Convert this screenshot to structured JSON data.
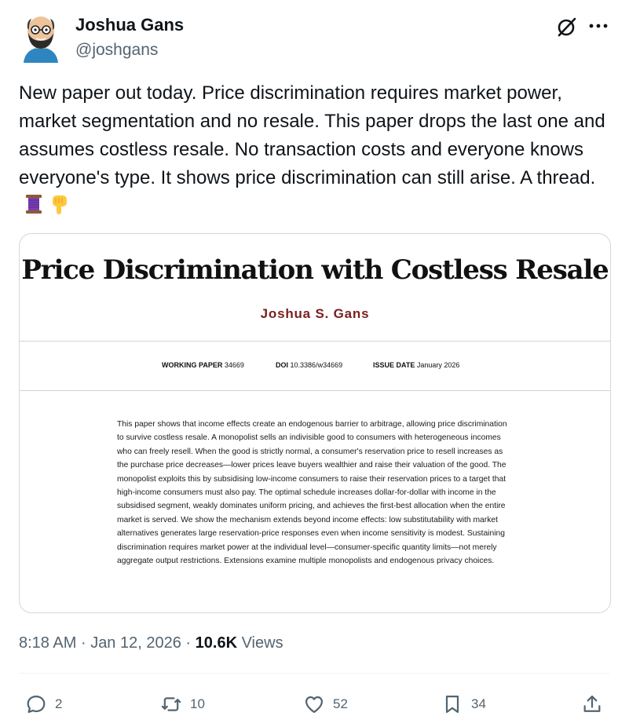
{
  "author": {
    "name": "Joshua Gans",
    "handle": "@joshgans",
    "avatar_icon": "cartoon-avatar-icon"
  },
  "header_icons": [
    "grok-icon",
    "more-options-icon"
  ],
  "tweet": {
    "text": "New paper out today. Price discrimination requires market power, market segmentation and no resale. This paper drops the last one and assumes costless resale. No transaction costs and everyone knows everyone's type. It shows price discrimination can still arise. A thread.",
    "emojis": [
      "thread-spool-icon",
      "pointing-down-icon"
    ]
  },
  "paper_card": {
    "title": "Price Discrimination with Costless Resale",
    "author": "Joshua S. Gans",
    "working_paper_label": "WORKING PAPER",
    "working_paper_value": "34669",
    "doi_label": "DOI",
    "doi_value": "10.3386/w34669",
    "issue_date_label": "ISSUE DATE",
    "issue_date_value": "January 2026",
    "abstract": "This paper shows that income effects create an endogenous barrier to arbitrage, allowing price discrimination to survive costless resale. A monopolist sells an indivisible good to consumers with heterogeneous incomes who can freely resell. When the good is strictly normal, a consumer's reservation price to resell increases as the purchase price decreases—lower prices leave buyers wealthier and raise their valuation of the good. The monopolist exploits this by subsidising low-income consumers to raise their reservation prices to a target that high-income consumers must also pay. The optimal schedule increases dollar-for-dollar with income in the subsidised segment, weakly dominates uniform pricing, and achieves the first-best allocation when the entire market is served. We show the mechanism extends beyond income effects: low substitutability with market alternatives generates large reservation-price responses even when income sensitivity is modest. Sustaining discrimination requires market power at the individual level—consumer-specific quantity limits—not merely aggregate output restrictions. Extensions examine multiple monopolists and endogenous privacy choices."
  },
  "post_meta": {
    "time": "8:18 AM",
    "separator": "·",
    "date": "Jan 12, 2026",
    "views_count": "10.6K",
    "views_label": "Views"
  },
  "actions": {
    "replies": "2",
    "reposts": "10",
    "likes": "52",
    "bookmarks": "34"
  },
  "colors": {
    "text": "#0f1419",
    "secondary": "#536471",
    "border": "#cfd9de",
    "paper_author": "#7a1f1f"
  }
}
